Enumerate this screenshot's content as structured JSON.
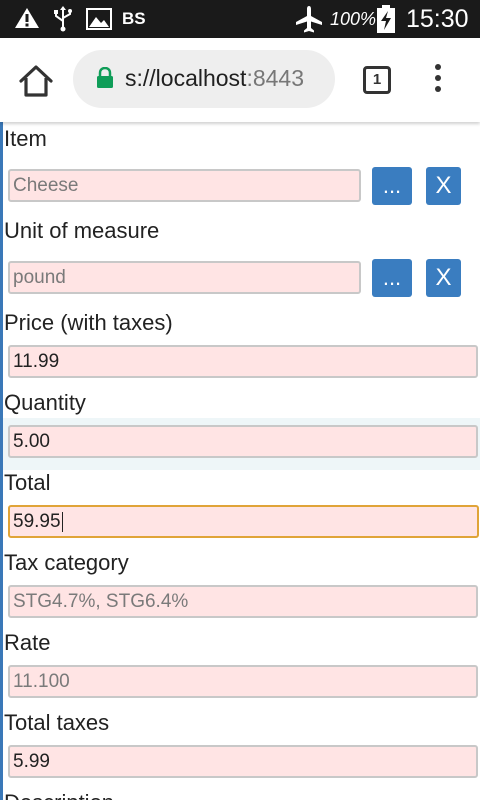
{
  "status_bar": {
    "network_label": "BS",
    "battery_percent": "100%",
    "time": "15:30"
  },
  "browser": {
    "url_prefix": "s://localhost",
    "url_port": ":8443",
    "tab_count": "1"
  },
  "form": {
    "item": {
      "label": "Item",
      "value": "Cheese",
      "select_label": "...",
      "clear_label": "X"
    },
    "unit": {
      "label": "Unit of measure",
      "value": "pound",
      "select_label": "...",
      "clear_label": "X"
    },
    "price": {
      "label": "Price (with taxes)",
      "value": "11.99"
    },
    "quantity": {
      "label": "Quantity",
      "value": "5.00"
    },
    "total": {
      "label": "Total",
      "value": "59.95"
    },
    "tax_category": {
      "label": "Tax category",
      "value": "STG4.7%, STG6.4%"
    },
    "rate": {
      "label": "Rate",
      "value": "11.100"
    },
    "total_taxes": {
      "label": "Total taxes",
      "value": "5.99"
    },
    "description": {
      "label": "Description"
    }
  },
  "colors": {
    "button_blue": "#3a7dc0",
    "field_pink": "#ffe4e4",
    "focus_orange": "#e0a438"
  }
}
